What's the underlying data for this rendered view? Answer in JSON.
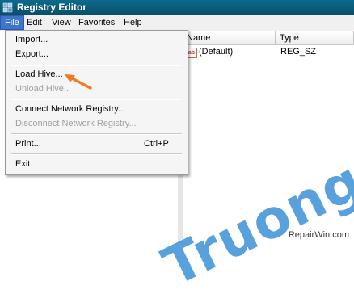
{
  "window": {
    "title": "Registry Editor"
  },
  "menubar": [
    "File",
    "Edit",
    "View",
    "Favorites",
    "Help"
  ],
  "file_menu": {
    "items": [
      {
        "label": "Import...",
        "enabled": true
      },
      {
        "label": "Export...",
        "enabled": true
      },
      {
        "label": "Load Hive...",
        "enabled": true
      },
      {
        "label": "Unload Hive...",
        "enabled": false
      },
      {
        "label": "Connect Network Registry...",
        "enabled": true
      },
      {
        "label": "Disconnect Network Registry...",
        "enabled": false
      },
      {
        "label": "Print...",
        "enabled": true,
        "shortcut": "Ctrl+P"
      },
      {
        "label": "Exit",
        "enabled": true
      }
    ]
  },
  "list": {
    "columns": [
      "Name",
      "Type"
    ],
    "rows": [
      {
        "icon": "string-value-icon",
        "name": "(Default)",
        "type": "REG_SZ"
      }
    ]
  },
  "annotation": {
    "icon": "orange-arrow-icon",
    "color": "#f07b22"
  },
  "watermark": {
    "text": "Truongtin.top",
    "caption": "RepairWin.com",
    "color": "#348cd6"
  },
  "colors": {
    "titlebar": "#0d6a8c",
    "menu_highlight": "#3e74c9"
  }
}
